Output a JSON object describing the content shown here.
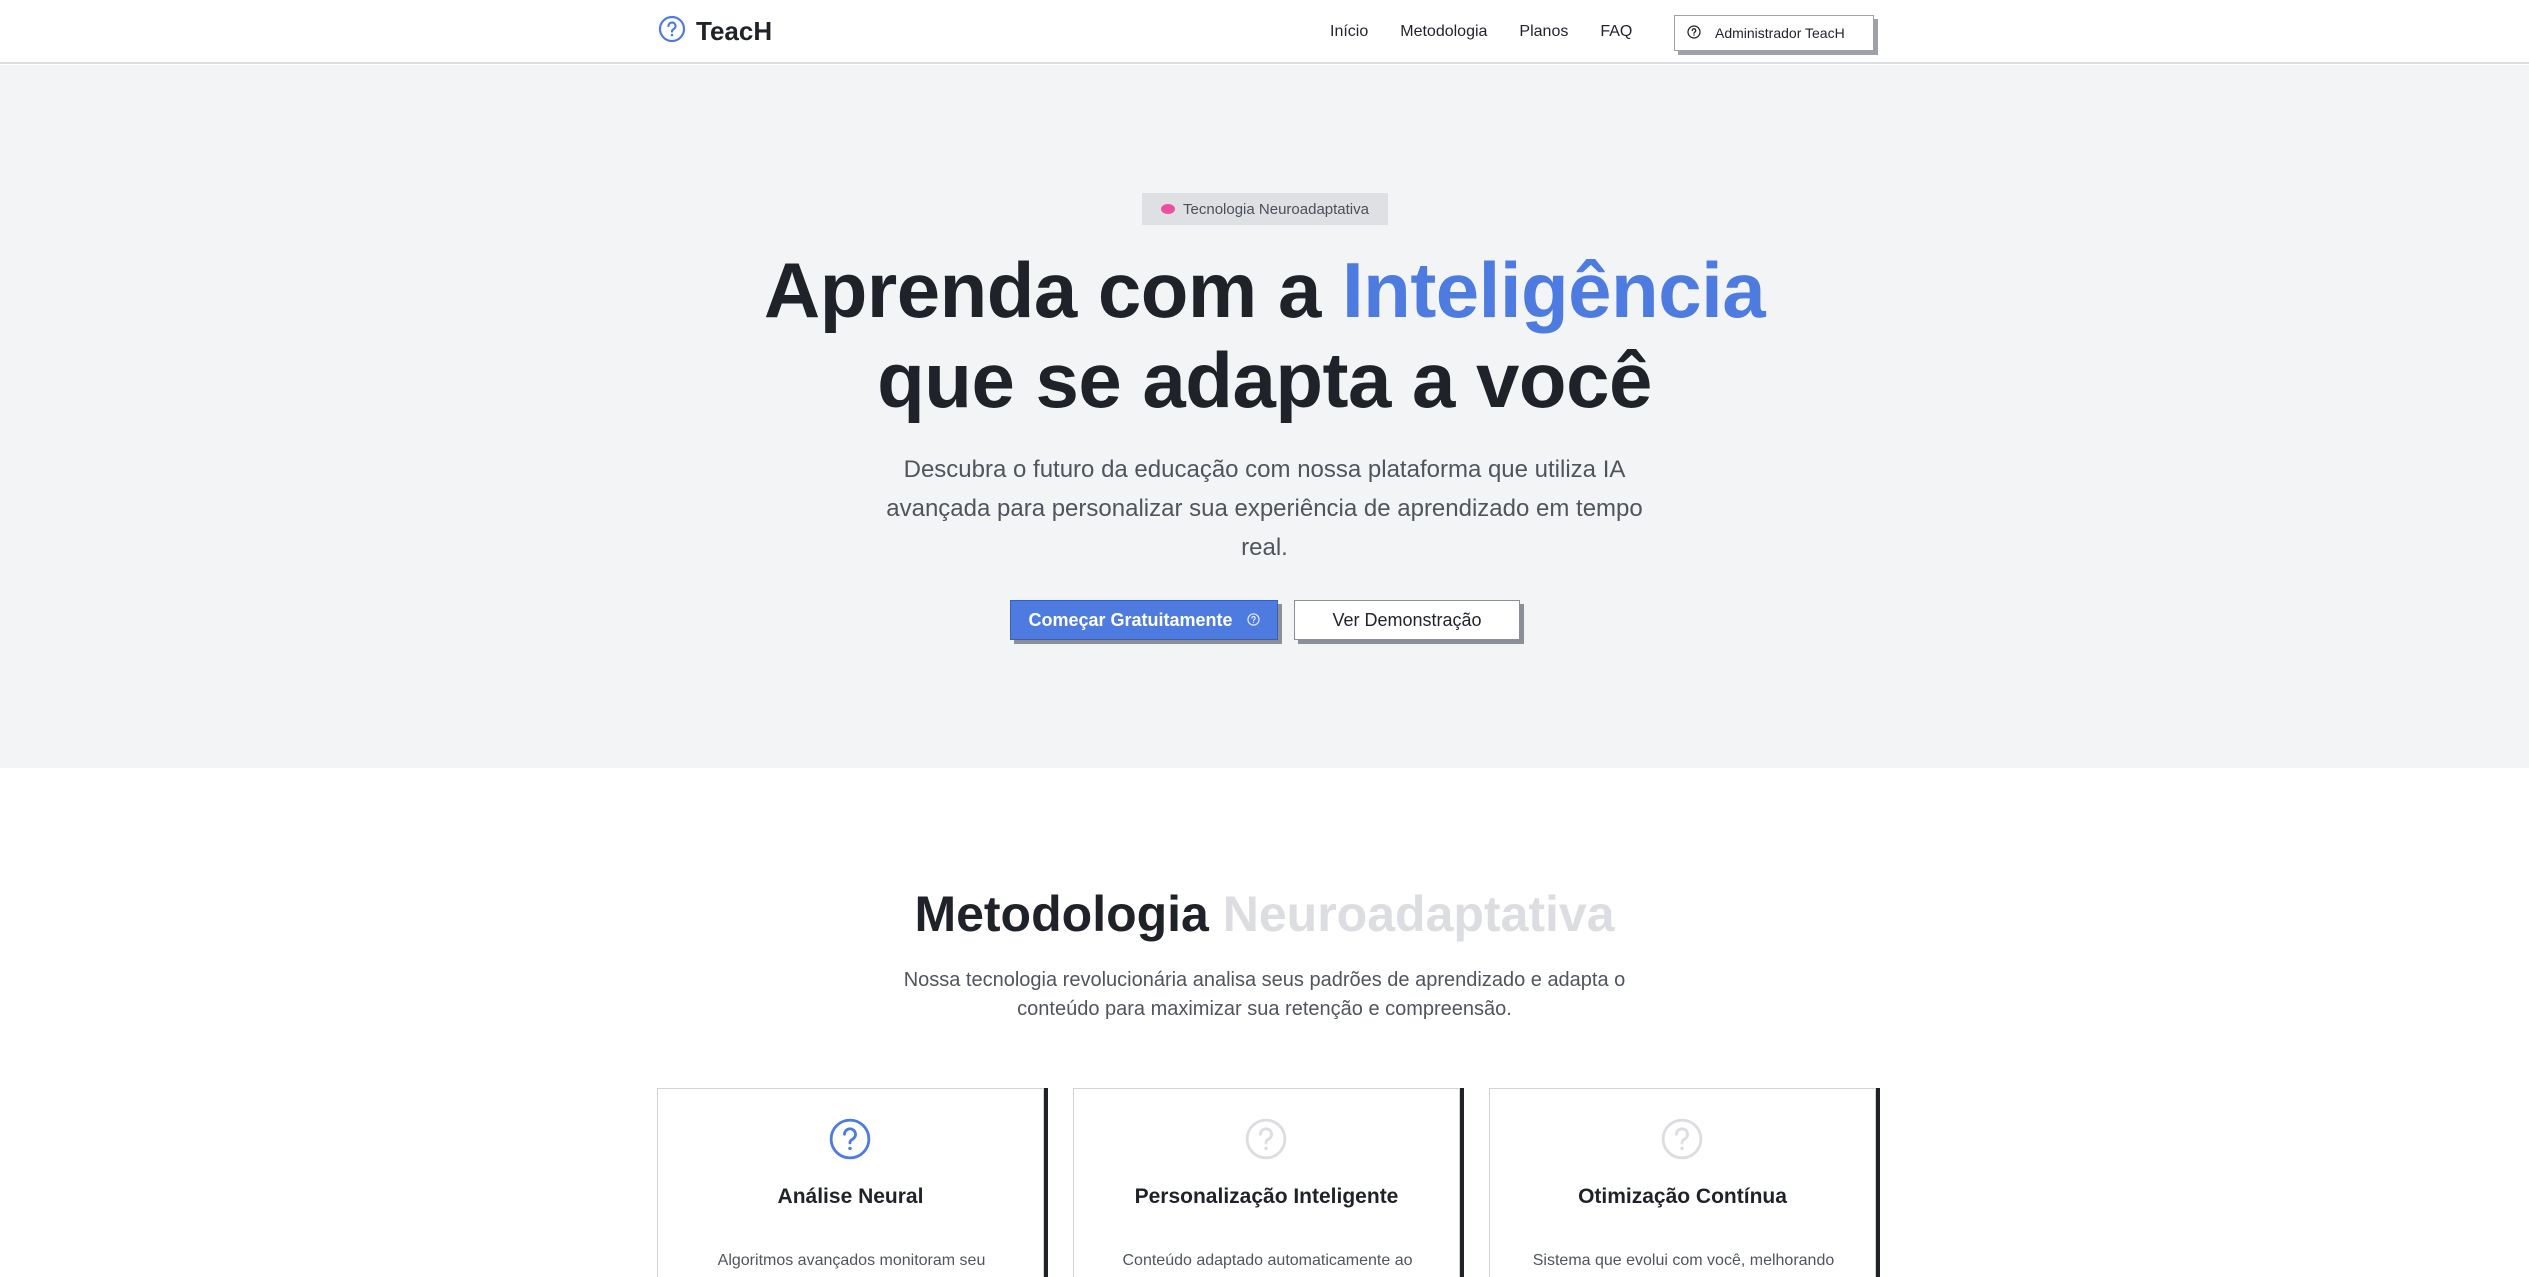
{
  "header": {
    "brand": "TeacH",
    "nav": [
      "Início",
      "Metodologia",
      "Planos",
      "FAQ"
    ],
    "user_label": "Administrador TeacH"
  },
  "hero": {
    "badge": "Tecnologia Neuroadaptativa",
    "title_line1_part1": "Aprenda com a ",
    "title_line1_accent": "Inteligência",
    "title_line2": "que se adapta a você",
    "subtitle": "Descubra o futuro da educação com nossa plataforma que utiliza IA avançada para personalizar sua experiência de aprendizado em tempo real.",
    "cta_primary": "Começar Gratuitamente",
    "cta_secondary": "Ver Demonstração"
  },
  "methodology": {
    "title_part1": "Metodologia ",
    "title_part2": "Neuroadaptativa",
    "subtitle": "Nossa tecnologia revolucionária analisa seus padrões de aprendizado e adapta o conteúdo para maximizar sua retenção e compreensão.",
    "cards": [
      {
        "title": "Análise Neural",
        "text": "Algoritmos avançados monitoram seu",
        "icon": "question-circle-icon",
        "icon_color": "#4d7be0"
      },
      {
        "title": "Personalização Inteligente",
        "text": "Conteúdo adaptado automaticamente ao",
        "icon": "question-circle-icon",
        "icon_color": "#dcdde0"
      },
      {
        "title": "Otimização Contínua",
        "text": "Sistema que evolui com você, melhorando",
        "icon": "question-circle-icon",
        "icon_color": "#dcdde0"
      }
    ]
  },
  "colors": {
    "accent": "#4d7be0",
    "hero_bg": "#f3f4f6",
    "text_dark": "#1f2329",
    "muted": "#dcdde0"
  }
}
